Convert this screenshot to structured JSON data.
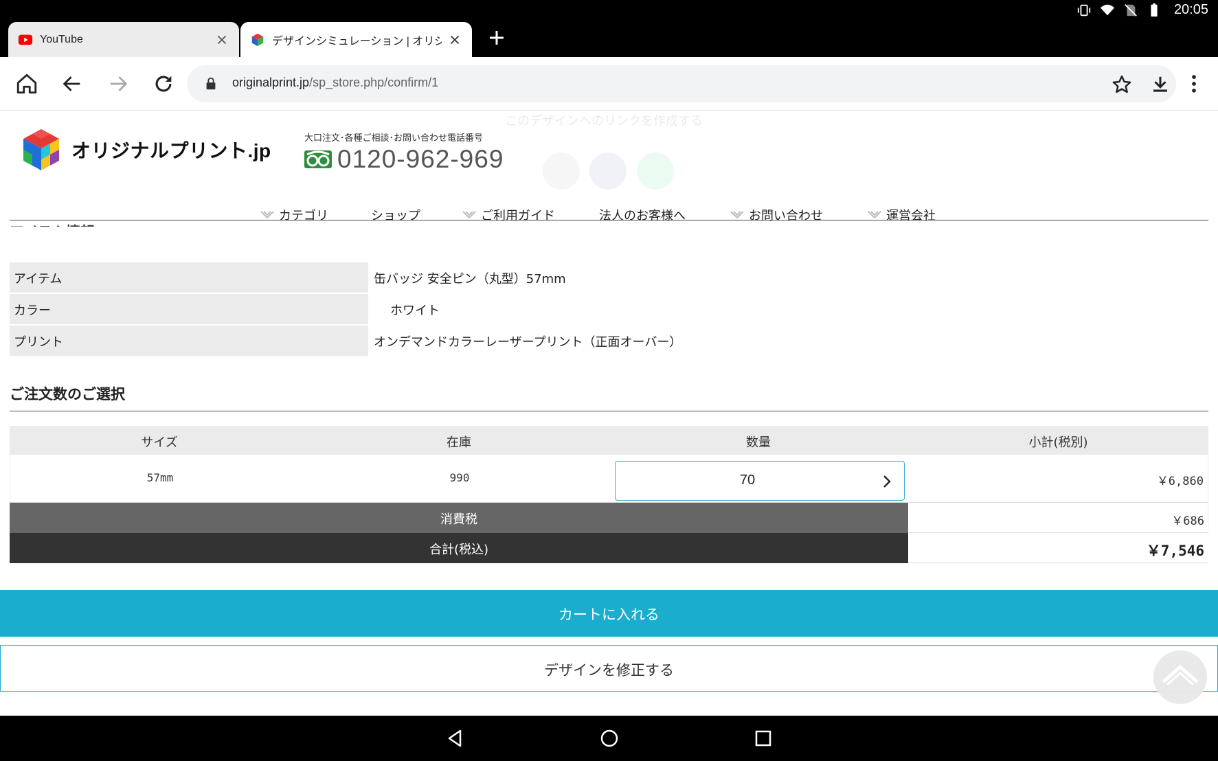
{
  "status": {
    "time": "20:05"
  },
  "tabs": [
    {
      "title": "YouTube"
    },
    {
      "title": "デザインシミュレーション | オリジ"
    }
  ],
  "toolbar": {
    "url_host": "originalprint.jp",
    "url_path": "/sp_store.php/confirm/1"
  },
  "overlay": {
    "share_text": "このデザインへのリンクを作成する"
  },
  "header": {
    "logo_text": "オリジナルプリント.jp",
    "phone_caption": "大口注文･各種ご相談･お問い合わせ電話番号",
    "phone_number": "0120-962-969"
  },
  "nav": {
    "items": [
      {
        "label": "カテゴリ"
      },
      {
        "label": "ショップ"
      },
      {
        "label": "ご利用ガイド"
      },
      {
        "label": "法人のお客様へ"
      },
      {
        "label": "お問い合わせ"
      },
      {
        "label": "運営会社"
      }
    ]
  },
  "item_info": {
    "section_title": "アイテム情報",
    "rows": [
      {
        "label": "アイテム",
        "value": "缶バッジ 安全ピン（丸型）57mm"
      },
      {
        "label": "カラー",
        "value": "ホワイト"
      },
      {
        "label": "プリント",
        "value": "オンデマンドカラーレーザープリント（正面オーバー）"
      }
    ]
  },
  "order": {
    "section_title": "ご注文数のご選択",
    "headers": {
      "size": "サイズ",
      "stock": "在庫",
      "qty": "数量",
      "subtotal": "小計(税別)"
    },
    "row": {
      "size": "57mm",
      "stock": "990",
      "qty": "70",
      "subtotal": "￥6,860"
    },
    "tax_label": "消費税",
    "tax_value": "￥686",
    "total_label": "合計(税込)",
    "total_value": "￥7,546"
  },
  "buttons": {
    "cart": "カートに入れる",
    "edit": "デザインを修正する"
  },
  "colors": {
    "accent": "#1badce",
    "freedial": "#2d8f3c"
  }
}
